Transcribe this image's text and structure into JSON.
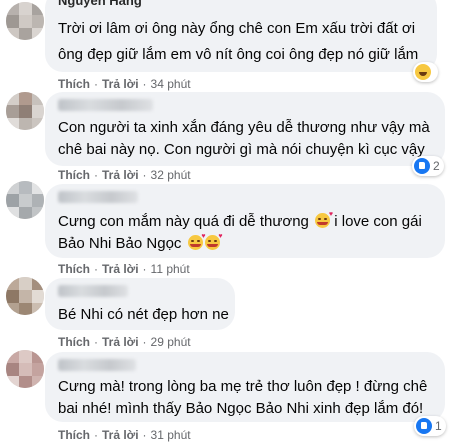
{
  "comments": [
    {
      "name_partial": "Nguyễn Hằng",
      "lines": [
        "Trời ơi lâm ơi ông này ổng chê con Em xấu trời đất ơi",
        "ông đẹp giữ lắm em vô nít ông coi ông đẹp nó giữ lắm"
      ],
      "like": "Thích",
      "reply": "Trả lời",
      "time": "34 phút",
      "reaction_icon": "haha-icon",
      "reaction_count": ""
    },
    {
      "lines": [
        "Con người ta xinh xắn đáng yêu dễ thương như vậy mà",
        "chê bai này nọ. Con người gì mà nói chuyện kì cục vậy"
      ],
      "like": "Thích",
      "reply": "Trả lời",
      "time": "32 phút",
      "reaction_icon": "like-icon",
      "reaction_count": "2"
    },
    {
      "lines": [
        "Cưng con mắm này quá đi dễ thương",
        "i love con gái",
        "Bảo Nhi Bảo Ngọc"
      ],
      "like": "Thích",
      "reply": "Trả lời",
      "time": "11 phút"
    },
    {
      "lines": [
        "Bé Nhi có nét đẹp hơn ne"
      ],
      "like": "Thích",
      "reply": "Trả lời",
      "time": "29 phút"
    },
    {
      "lines": [
        "Cưng mà! trong lòng ba mẹ trẻ thơ luôn đẹp ! đừng chê",
        "bai nhé! mình thấy Bảo Ngọc Bảo Nhi xinh đẹp lắm đó!"
      ],
      "like": "Thích",
      "reply": "Trả lời",
      "time": "31 phút",
      "reaction_icon": "like-icon",
      "reaction_count": "1"
    }
  ],
  "colors": {
    "bubble": "#f0f2f5",
    "meta": "#65676b",
    "text": "#050505",
    "like": "#1877f2"
  }
}
